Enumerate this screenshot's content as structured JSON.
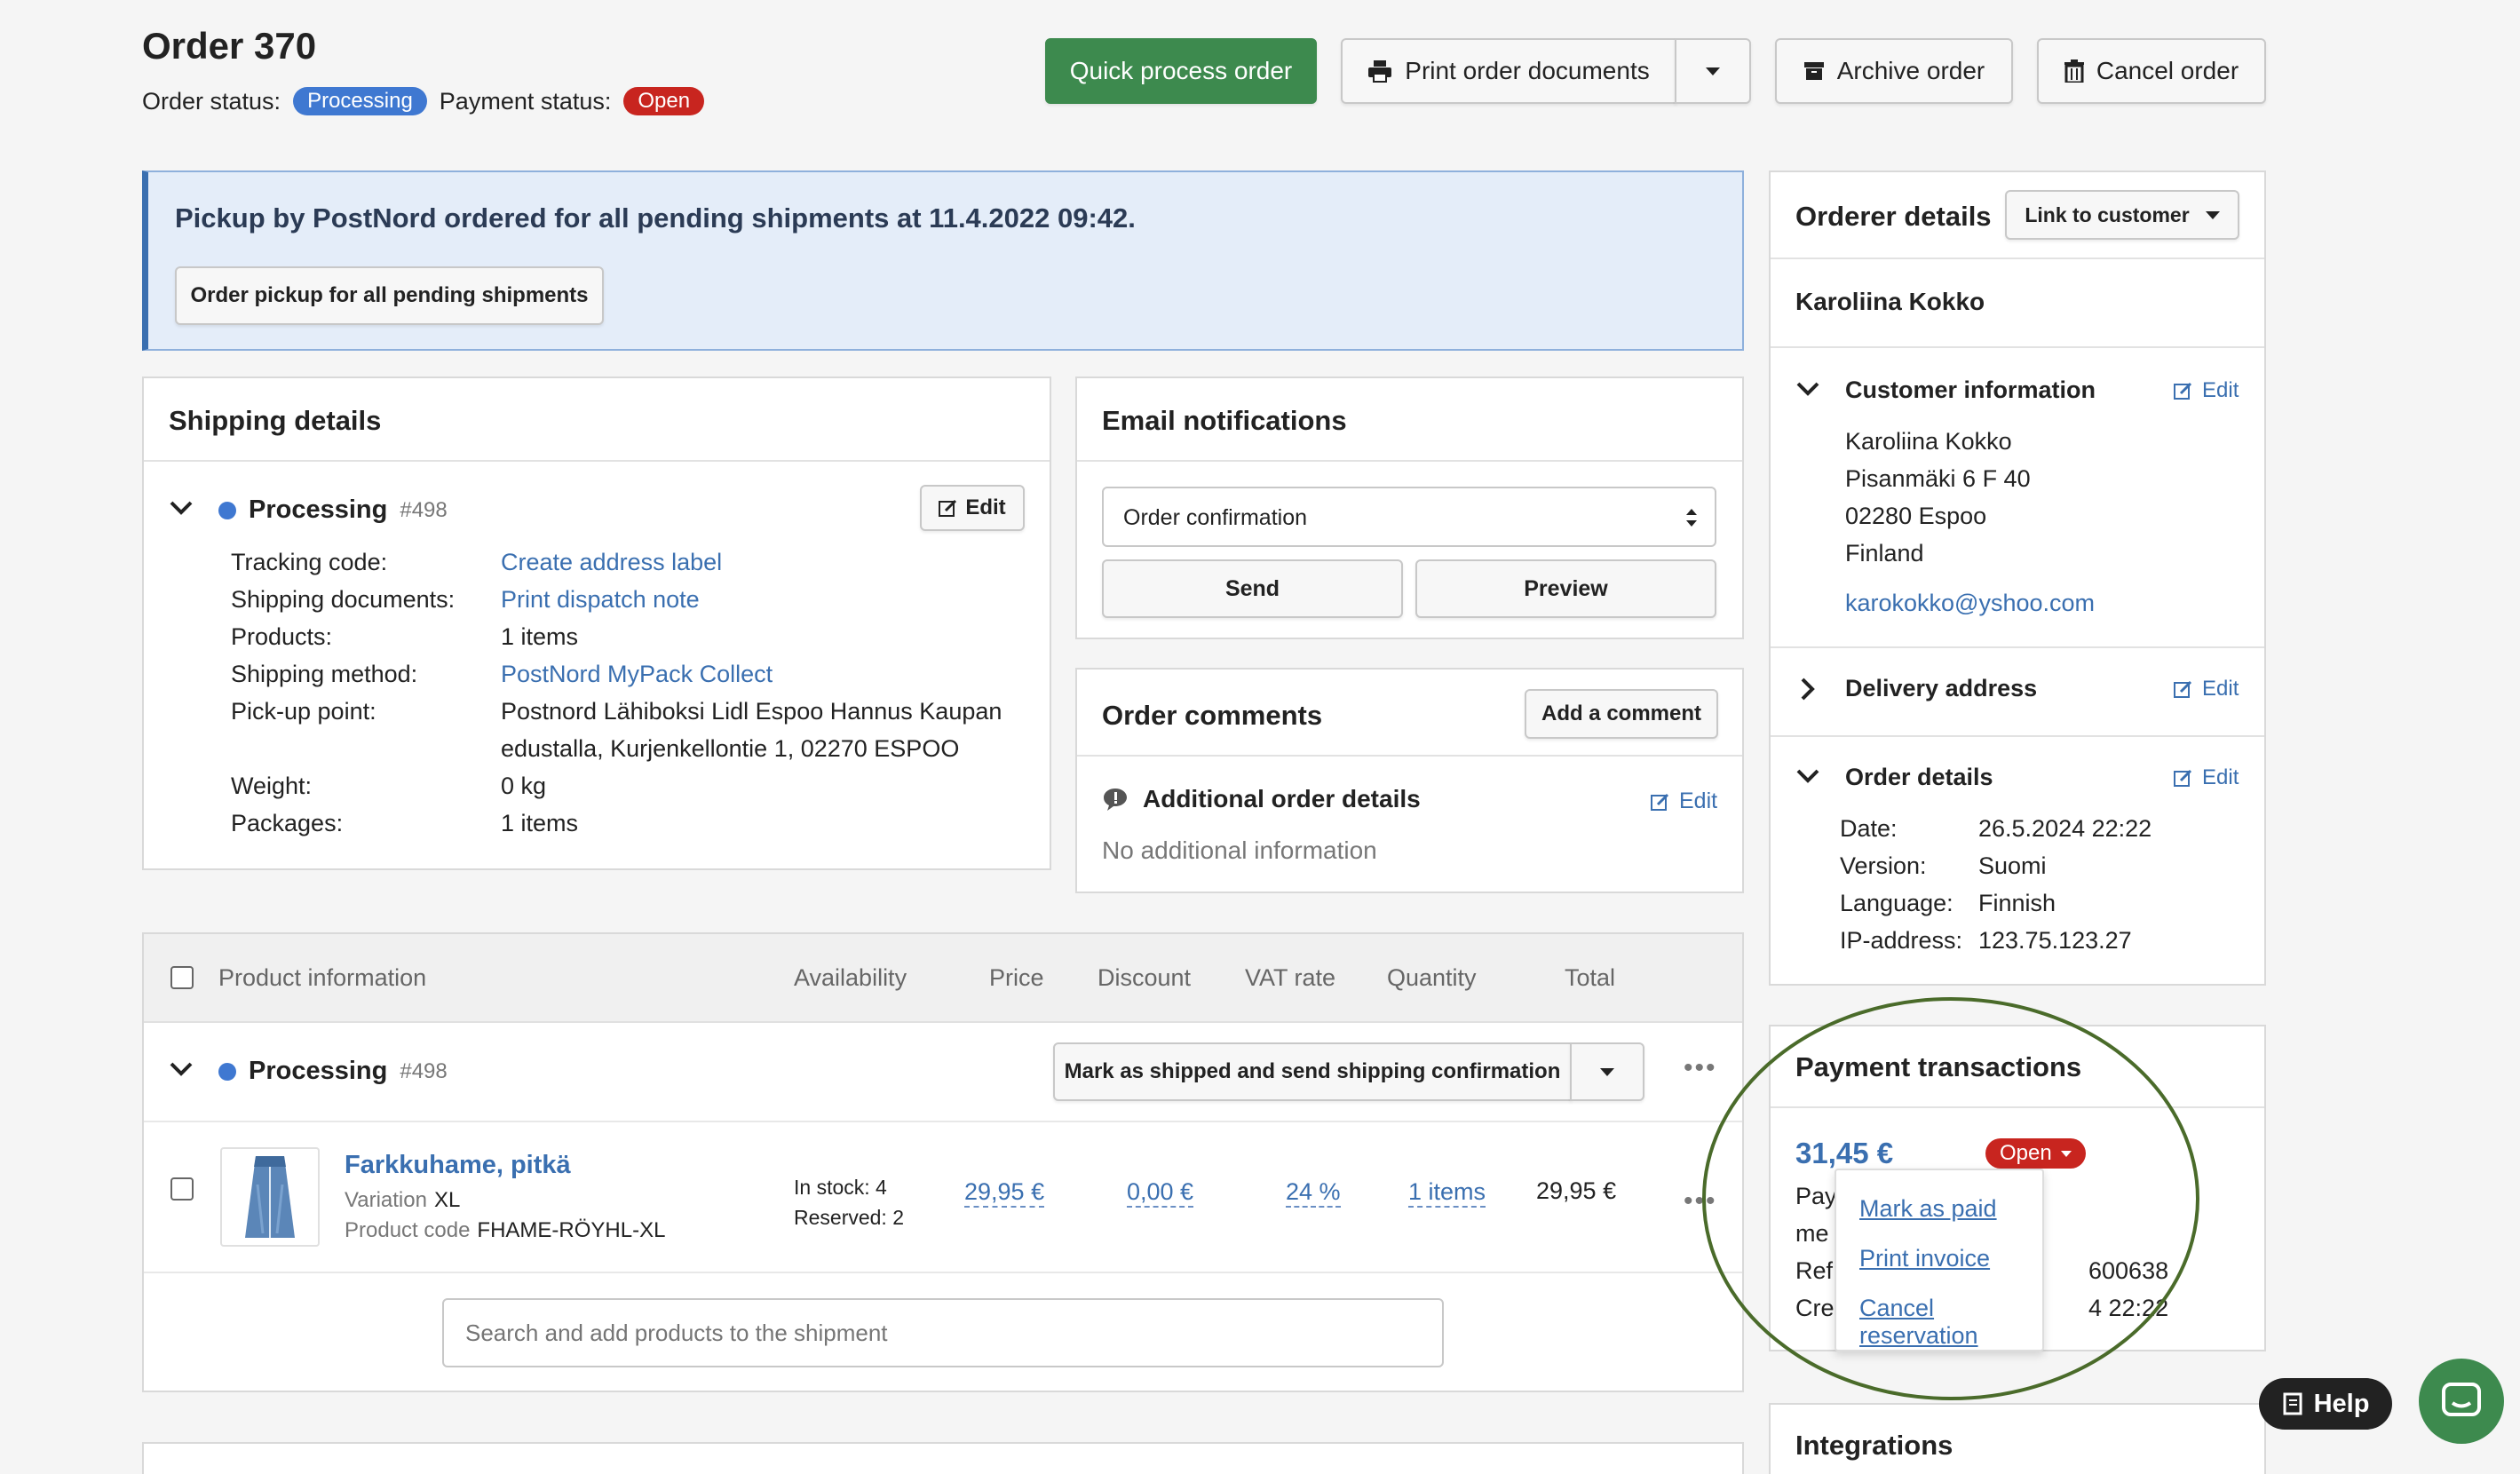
{
  "header": {
    "title": "Order 370",
    "order_status_label": "Order status:",
    "order_status": "Processing",
    "payment_status_label": "Payment status:",
    "payment_status": "Open",
    "quick_process": "Quick process order",
    "print_docs": "Print order documents",
    "archive": "Archive order",
    "cancel": "Cancel order"
  },
  "banner": {
    "text": "Pickup by PostNord ordered for all pending shipments at 11.4.2022 09:42.",
    "button": "Order pickup for all pending shipments"
  },
  "shipping": {
    "title": "Shipping details",
    "status": "Processing",
    "number": "#498",
    "edit": "Edit",
    "fields": [
      {
        "label": "Tracking code:",
        "value": "Create address label"
      },
      {
        "label": "Shipping documents:",
        "value": "Print dispatch note"
      },
      {
        "label": "Products:",
        "value": "1 items"
      },
      {
        "label": "Shipping method:",
        "value": "PostNord MyPack Collect"
      },
      {
        "label": "Pick-up point:",
        "value": "Postnord Lähiboksi Lidl Espoo Hannus Kaupan",
        "value2": "edustalla, Kurjenkellontie 1, 02270 ESPOO"
      },
      {
        "label": "Weight:",
        "value": "0 kg"
      },
      {
        "label": "Packages:",
        "value": "1 items"
      }
    ]
  },
  "email": {
    "title": "Email notifications",
    "selected": "Order confirmation",
    "send": "Send",
    "preview": "Preview"
  },
  "comments": {
    "title": "Order comments",
    "add": "Add a comment",
    "additional_title": "Additional order details",
    "edit": "Edit",
    "additional_text": "No additional information"
  },
  "products": {
    "columns": [
      "Product information",
      "Availability",
      "Price",
      "Discount",
      "VAT rate",
      "Quantity",
      "Total"
    ],
    "group_status": "Processing",
    "group_number": "#498",
    "mark_shipped": "Mark as shipped and send shipping confirmation",
    "item": {
      "name": "Farkkuhame, pitkä",
      "variation_label": "Variation",
      "variation": "XL",
      "code_label": "Product code",
      "code": "FHAME-RÖYHL-XL",
      "in_stock": "In stock: 4",
      "reserved": "Reserved: 2",
      "price": "29,95 €",
      "discount": "0,00 €",
      "vat": "24 %",
      "quantity": "1 items",
      "total": "29,95 €"
    },
    "search_placeholder": "Search and add products to the shipment"
  },
  "orderer": {
    "title": "Orderer details",
    "link_customer": "Link to customer",
    "name": "Karoliina Kokko",
    "customer_info_title": "Customer information",
    "edit": "Edit",
    "address": [
      "Karoliina Kokko",
      "Pisanmäki 6 F 40",
      "02280 Espoo",
      "Finland"
    ],
    "email": "karokokko@yshoo.com",
    "delivery_title": "Delivery address",
    "order_details_title": "Order details",
    "details": [
      {
        "label": "Date:",
        "value": "26.5.2024 22:22"
      },
      {
        "label": "Version:",
        "value": "Suomi"
      },
      {
        "label": "Language:",
        "value": "Finnish"
      },
      {
        "label": "IP-address:",
        "value": "123.75.123.27"
      }
    ]
  },
  "payment": {
    "title": "Payment transactions",
    "amount": "31,45 €",
    "status": "Open",
    "partial": [
      "Pay",
      "me",
      "Ref",
      "Cre"
    ],
    "partial_values": [
      "600638",
      "4 22:22"
    ],
    "menu": [
      "Mark as paid",
      "Print invoice",
      "Cancel reservation"
    ]
  },
  "integrations": {
    "title": "Integrations"
  },
  "help": {
    "label": "Help"
  },
  "colors": {
    "primary": "#3d8a4e",
    "link": "#3a6fb0",
    "processing": "#3f78d1",
    "open": "#c8251f",
    "annotation": "#4a6b2a"
  }
}
